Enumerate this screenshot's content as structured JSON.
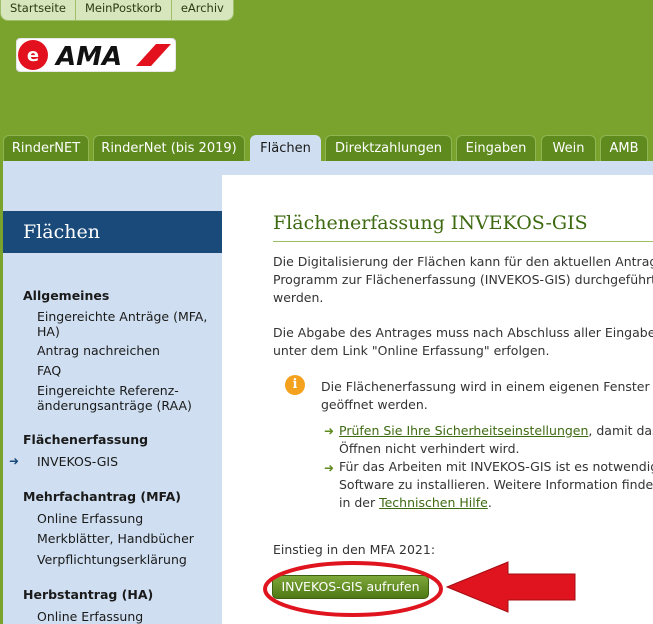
{
  "top_nav": [
    "Startseite",
    "MeinPostkorb",
    "eArchiv"
  ],
  "logo": {
    "prefix": "e",
    "brand": "AMA"
  },
  "main_nav": [
    "RinderNET",
    "RinderNet (bis 2019)",
    "Flächen",
    "Direktzahlungen",
    "Eingaben",
    "Wein",
    "AMB"
  ],
  "active_tab": "Flächen",
  "sidebar": {
    "title": "Flächen",
    "sections": {
      "allgemeines": "Allgemeines",
      "flaechen": "Flächenerfassung",
      "mfa": "Mehrfachantrag (MFA)",
      "ha": "Herbstantrag (HA)"
    },
    "items": {
      "eingereichte_1": "Eingereichte Anträge (MFA,",
      "eingereichte_2": "HA)",
      "nachreichen": "Antrag nachreichen",
      "faq": "FAQ",
      "referenz_1": "Eingereichte Referenz-",
      "referenz_2": "änderungsanträge (RAA)",
      "invekos": "INVEKOS-GIS",
      "online_mfa": "Online Erfassung",
      "merkblaetter": "Merkblätter, Handbücher",
      "verpflichtung": "Verpflichtungserklärung",
      "online_ha": "Online Erfassung"
    }
  },
  "content": {
    "title": "Flächenerfassung INVEKOS-GIS",
    "p1_l1": "Die Digitalisierung der Flächen kann für den aktuellen Antrag",
    "p1_l2": "Programm zur Flächenerfassung (INVEKOS-GIS) durchgeführt",
    "p1_l3": "werden.",
    "p2_l1": "Die Abgabe des Antrages muss nach Abschluss aller Eingaben",
    "p2_l2": "unter dem Link \"Online Erfassung\" erfolgen.",
    "info_l1": "Die Flächenerfassung wird in einem eigenen Fenster",
    "info_l2": "geöffnet werden.",
    "b1_link": "Prüfen Sie Ihre Sicherheitseinstellungen",
    "b1_rest": ", damit das",
    "b1_l2": "Öffnen nicht verhindert wird.",
    "b2_l1": "Für das Arbeiten mit INVEKOS-GIS ist es notwendig",
    "b2_l2": "Software zu installieren. Weitere Information finden",
    "b2_pre": "in der ",
    "b2_link": "Technischen Hilfe",
    "b2_post": ".",
    "einstieg": "Einstieg in den MFA 2021:",
    "button": "INVEKOS-GIS aufrufen"
  },
  "colors": {
    "page_bg": "#7aa32e",
    "nav": "#5e8a1e",
    "sidebar": "#cfdff1",
    "title_bar": "#194a7a",
    "annotation": "#e0141e"
  }
}
